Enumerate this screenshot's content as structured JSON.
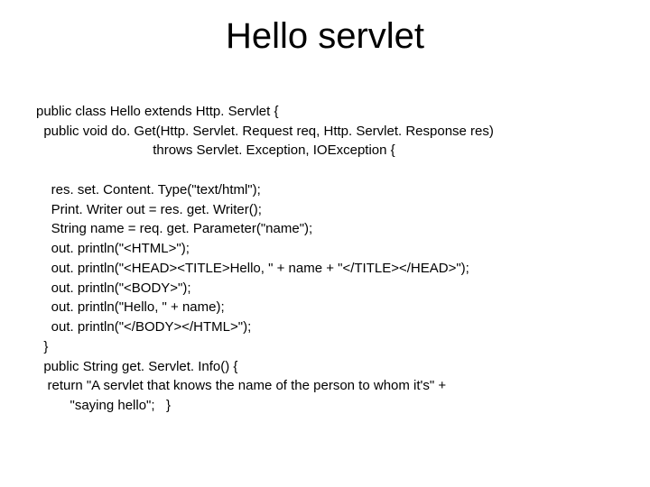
{
  "slide": {
    "title": "Hello servlet",
    "code_lines": {
      "l0": "public class Hello extends Http. Servlet {",
      "l1": "  public void do. Get(Http. Servlet. Request req, Http. Servlet. Response res)",
      "l2": "                               throws Servlet. Exception, IOException {",
      "l3": "",
      "l4": "    res. set. Content. Type(\"text/html\");",
      "l5": "    Print. Writer out = res. get. Writer();",
      "l6": "    String name = req. get. Parameter(\"name\");",
      "l7": "    out. println(\"<HTML>\");",
      "l8": "    out. println(\"<HEAD><TITLE>Hello, \" + name + \"</TITLE></HEAD>\");",
      "l9": "    out. println(\"<BODY>\");",
      "l10": "    out. println(\"Hello, \" + name);",
      "l11": "    out. println(\"</BODY></HTML>\");",
      "l12": "  }",
      "l13": "  public String get. Servlet. Info() {",
      "l14": "   return \"A servlet that knows the name of the person to whom it's\" +",
      "l15": "         \"saying hello\";   }"
    }
  }
}
